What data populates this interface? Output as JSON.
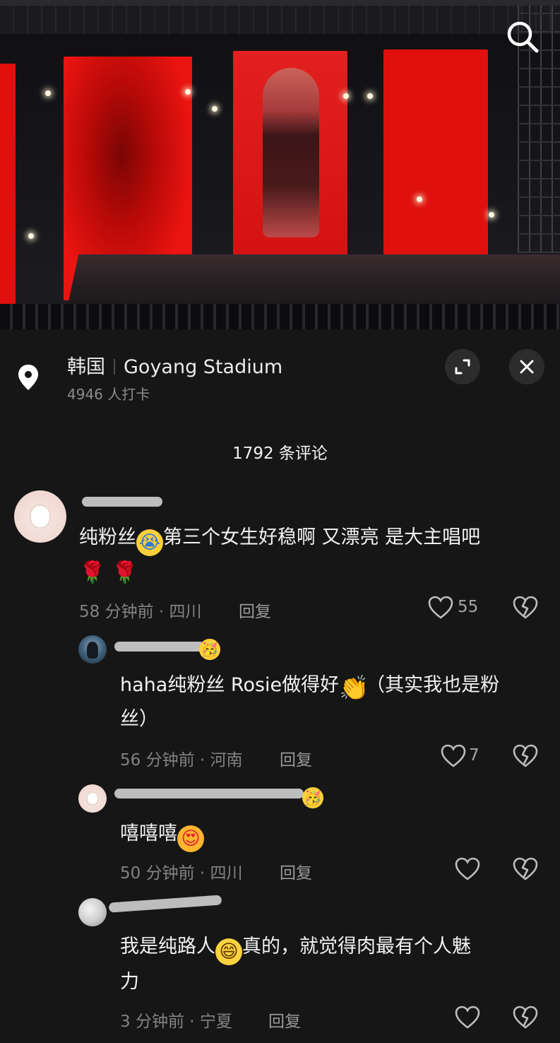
{
  "video": {
    "search_icon": "search-icon"
  },
  "location": {
    "country": "韩国",
    "place": "Goyang Stadium",
    "checkins": "4946 人打卡",
    "icons": [
      "location-pin-icon",
      "expand-icon",
      "close-icon"
    ]
  },
  "comments_header": {
    "count_label": "1792 条评论"
  },
  "comments": [
    {
      "text_a": "纯粉丝",
      "text_b": "第三个女生好稳啊 又漂亮 是大主唱吧",
      "meta": "58 分钟前 · 四川",
      "reply": "回复",
      "likes": "55"
    },
    {
      "text_a": "haha纯粉丝 Rosie做得好",
      "text_b": "（其实我也是粉",
      "text_c": "丝）",
      "meta": "56 分钟前 · 河南",
      "reply": "回复",
      "likes": "7"
    },
    {
      "text_a": "嘻嘻嘻",
      "meta": "50 分钟前 · 四川",
      "reply": "回复"
    },
    {
      "text_a": "我是纯路人",
      "text_b": "真的，就觉得肉最有个人魅",
      "text_c": "力",
      "meta": "3 分钟前 · 宁夏",
      "reply": "回复"
    }
  ],
  "colors": {
    "background": "#161616",
    "stage_red": "#e0100e",
    "meta_grey": "#838383"
  }
}
